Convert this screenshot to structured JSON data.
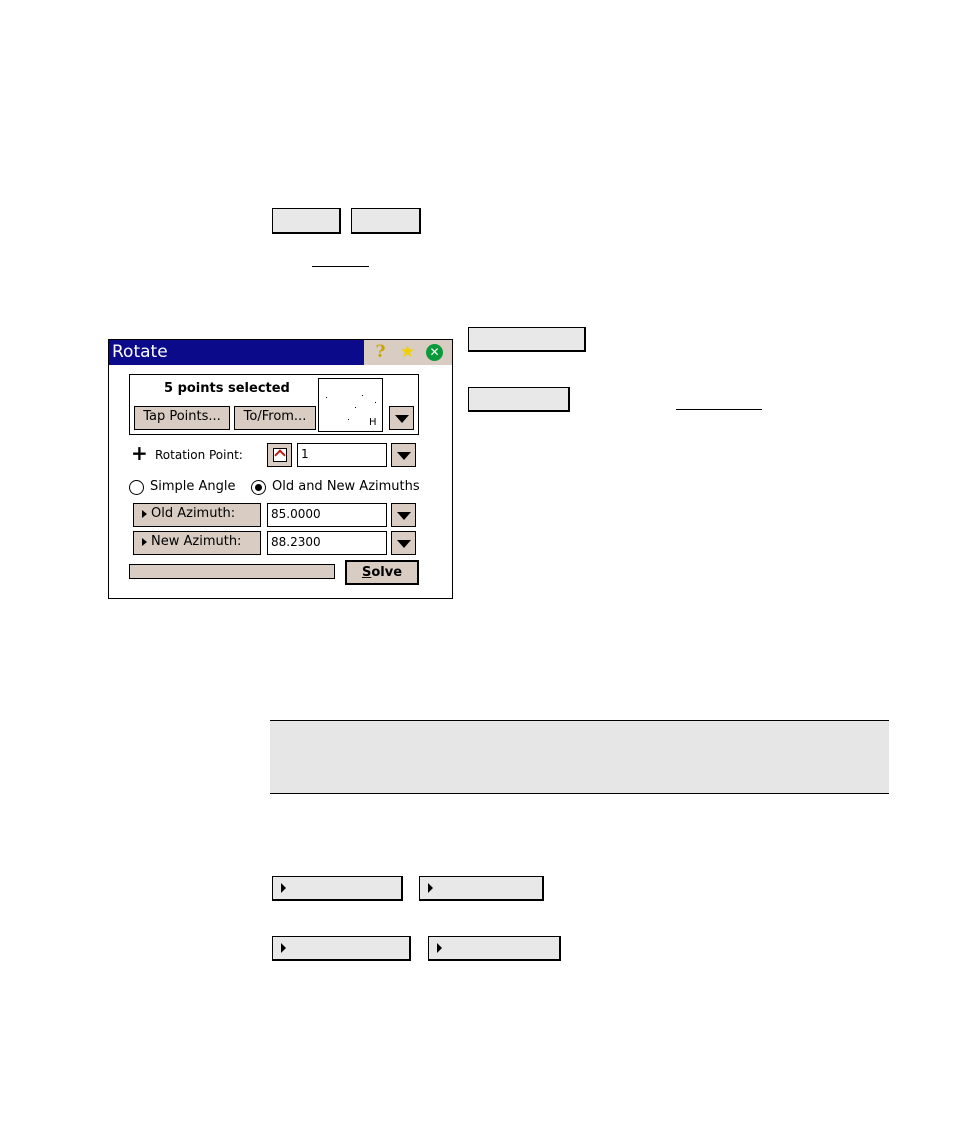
{
  "dialog": {
    "title": "Rotate",
    "title_icons": [
      "help-icon",
      "favorites-star-icon",
      "close-icon"
    ],
    "selection_text": "5 points selected",
    "tap_points_label": "Tap Points...",
    "to_from_label": "To/From...",
    "preview_label": "H",
    "rotation_point_label": "Rotation Point:",
    "rotation_point_value": "1",
    "radio_simple_angle": "Simple Angle",
    "radio_old_new": "Old and New Azimuths",
    "selected_radio": "Old and New Azimuths",
    "old_azimuth_label": "Old Azimuth:",
    "old_azimuth_value": "85.0000",
    "new_azimuth_label": "New Azimuth:",
    "new_azimuth_value": "88.2300",
    "solve_label": "Solve",
    "solve_mnemonic": "S",
    "solve_rest": "olve"
  },
  "colors": {
    "titlebar": "#0a0a8a",
    "button_face": "#d8ccc3",
    "close_green": "#0b9a3b",
    "doc_button": "#e8e8e8",
    "note_background": "#e6e6e6"
  }
}
